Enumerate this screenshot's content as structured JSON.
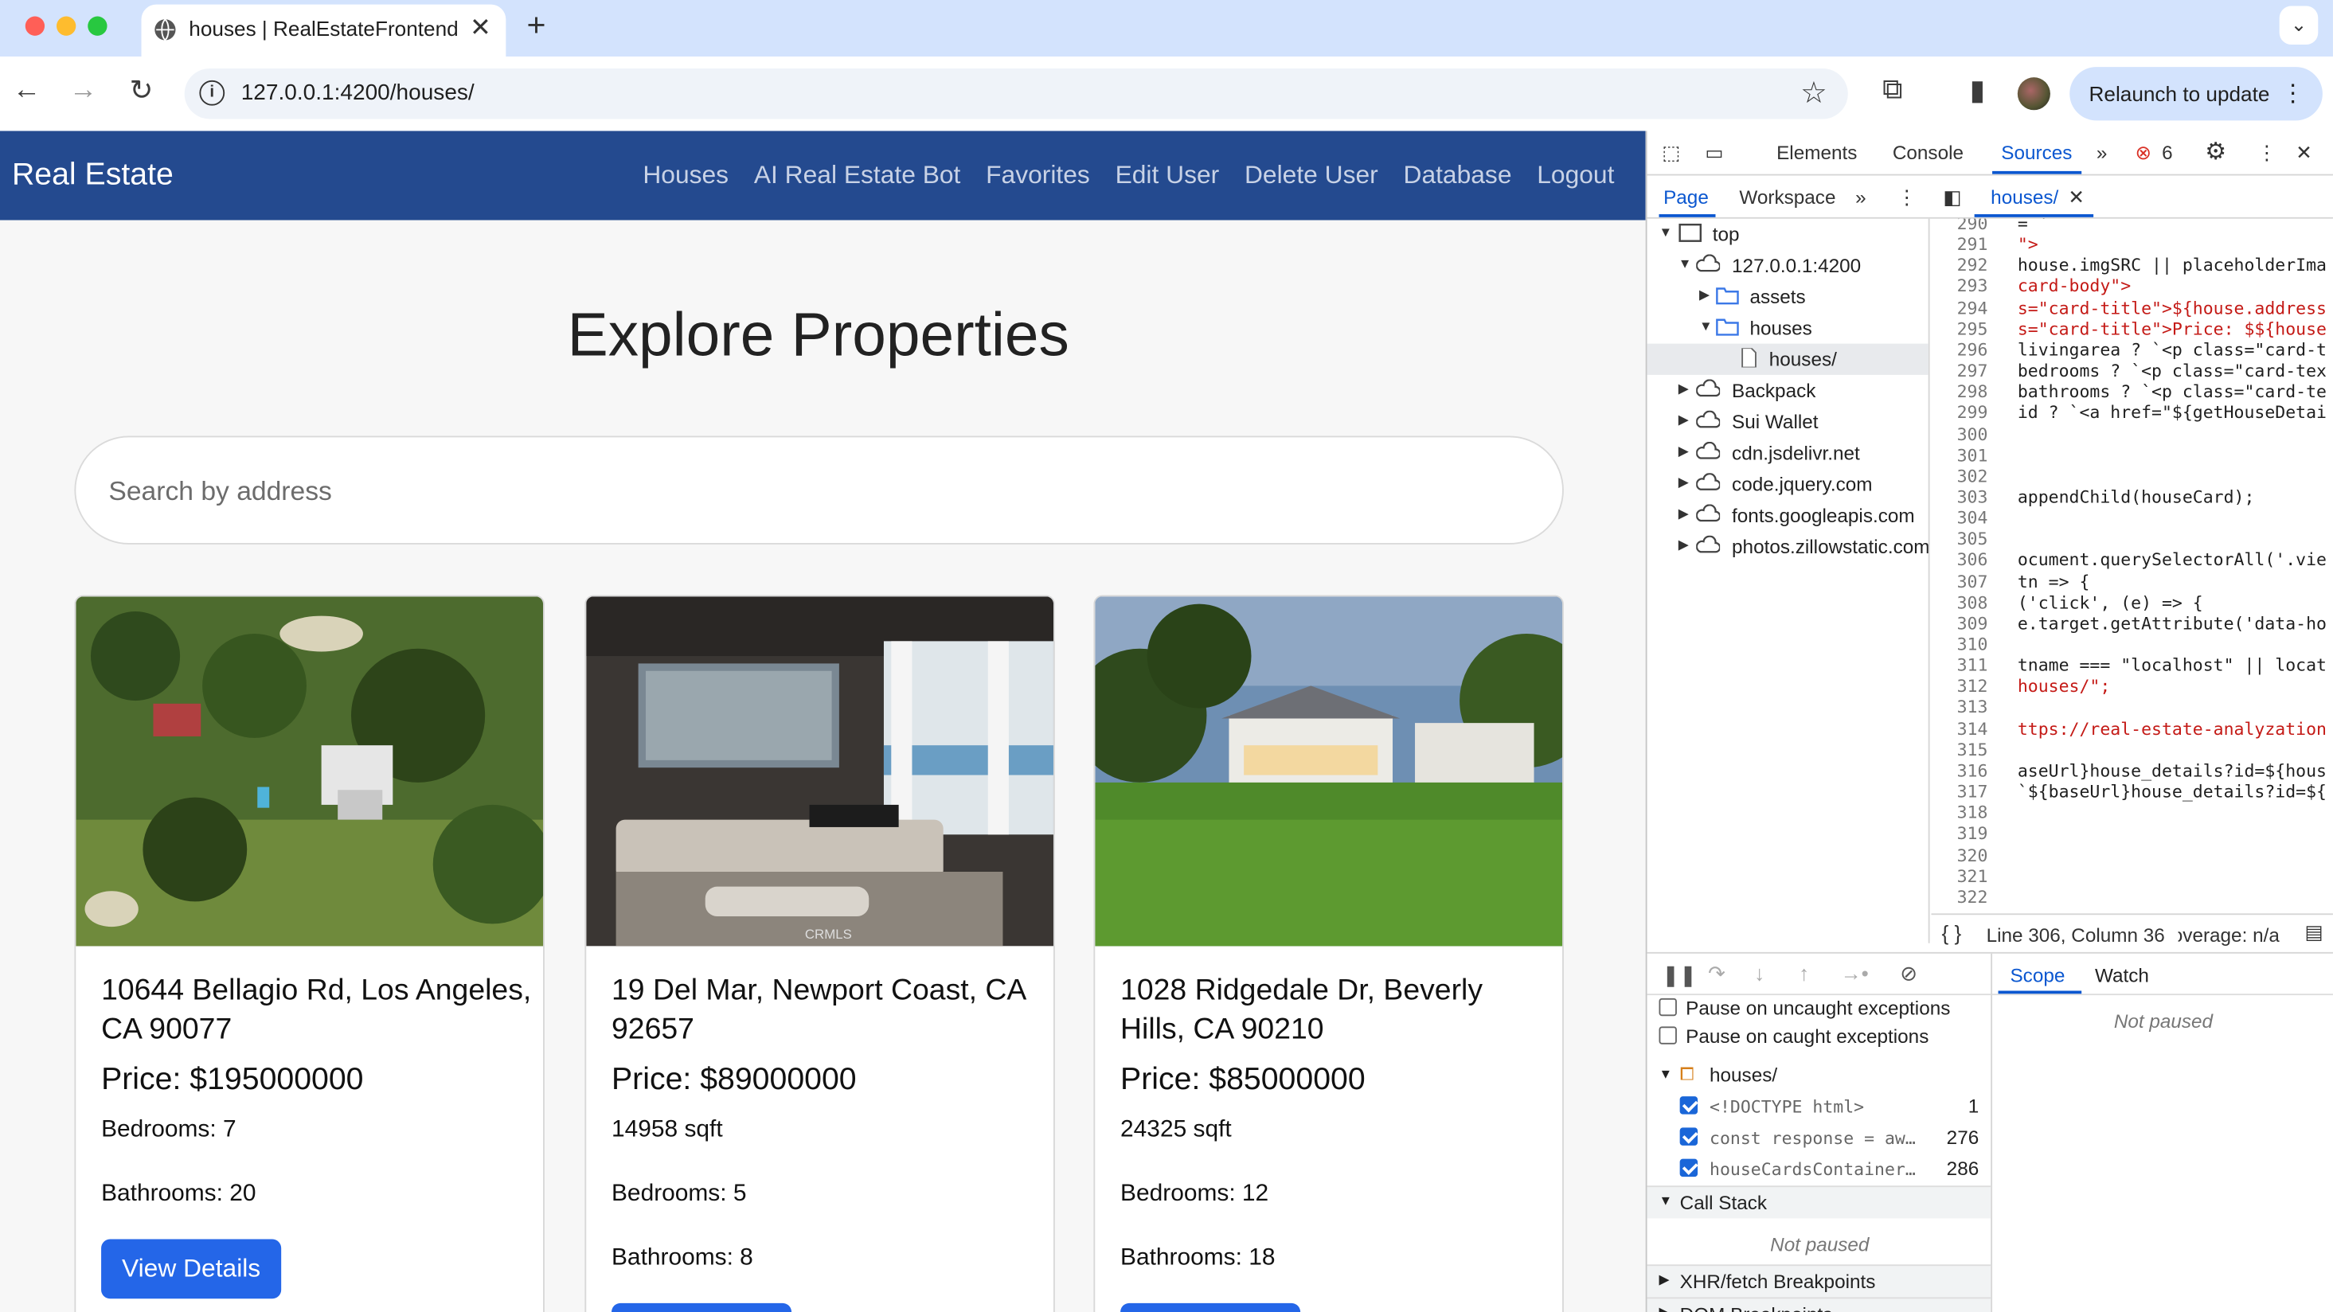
{
  "browser": {
    "tab_title": "houses | RealEstateFrontend",
    "url": "127.0.0.1:4200/houses/",
    "relaunch_label": "Relaunch to update"
  },
  "site": {
    "brand": "Real Estate",
    "nav": [
      "Houses",
      "AI Real Estate Bot",
      "Favorites",
      "Edit User",
      "Delete User",
      "Database",
      "Logout"
    ],
    "heading": "Explore Properties",
    "search_placeholder": "Search by address",
    "cards": [
      {
        "address": "10644 Bellagio Rd, Los Angeles, CA 90077",
        "price": "Price: $195000000",
        "line1": "Bedrooms: 7",
        "line2": "Bathrooms: 20",
        "button": "View Details"
      },
      {
        "address": "19 Del Mar, Newport Coast, CA 92657",
        "price": "Price: $89000000",
        "line1": "14958 sqft",
        "line2": "Bedrooms: 5",
        "line3": "Bathrooms: 8"
      },
      {
        "address": "1028 Ridgedale Dr, Beverly Hills, CA 90210",
        "price": "Price: $85000000",
        "line1": "24325 sqft",
        "line2": "Bedrooms: 12",
        "line3": "Bathrooms: 18"
      }
    ],
    "image_watermark": "CRMLS"
  },
  "devtools": {
    "tabs": [
      "Elements",
      "Console",
      "Sources"
    ],
    "error_count": "6",
    "subtabs": [
      "Page",
      "Workspace"
    ],
    "open_file": "houses/",
    "tree": [
      {
        "label": "top"
      },
      {
        "label": "127.0.0.1:4200"
      },
      {
        "label": "assets"
      },
      {
        "label": "houses"
      },
      {
        "label": "houses/"
      },
      {
        "label": "Backpack"
      },
      {
        "label": "Sui Wallet"
      },
      {
        "label": "cdn.jsdelivr.net"
      },
      {
        "label": "code.jquery.com"
      },
      {
        "label": "fonts.googleapis.com"
      },
      {
        "label": "photos.zillowstatic.com"
      }
    ],
    "code_lines": [
      {
        "n": "290",
        "t": "= `"
      },
      {
        "n": "291",
        "t": "\">"
      },
      {
        "n": "292",
        "t": "house.imgSRC || placeholderIma"
      },
      {
        "n": "293",
        "t": "card-body\">"
      },
      {
        "n": "294",
        "t": "s=\"card-title\">${house.address"
      },
      {
        "n": "295",
        "t": "s=\"card-title\">Price: $${house"
      },
      {
        "n": "296",
        "t": "livingarea ? `<p class=\"card-t"
      },
      {
        "n": "297",
        "t": "bedrooms ? `<p class=\"card-tex"
      },
      {
        "n": "298",
        "t": "bathrooms ? `<p class=\"card-te"
      },
      {
        "n": "299",
        "t": "id ? `<a href=\"${getHouseDetai"
      },
      {
        "n": "300",
        "t": ""
      },
      {
        "n": "301",
        "t": ""
      },
      {
        "n": "302",
        "t": ""
      },
      {
        "n": "303",
        "t": "appendChild(houseCard);"
      },
      {
        "n": "304",
        "t": ""
      },
      {
        "n": "305",
        "t": ""
      },
      {
        "n": "306",
        "t": "ocument.querySelectorAll('.vie"
      },
      {
        "n": "307",
        "t": "tn => {"
      },
      {
        "n": "308",
        "t": "('click', (e) => {"
      },
      {
        "n": "309",
        "t": "e.target.getAttribute('data-ho"
      },
      {
        "n": "310",
        "t": ""
      },
      {
        "n": "311",
        "t": "tname === \"localhost\" || locat"
      },
      {
        "n": "312",
        "t": "houses/\";"
      },
      {
        "n": "313",
        "t": ""
      },
      {
        "n": "314",
        "t": "ttps://real-estate-analyzation"
      },
      {
        "n": "315",
        "t": ""
      },
      {
        "n": "316",
        "t": "aseUrl}house_details?id=${hous"
      },
      {
        "n": "317",
        "t": "`${baseUrl}house_details?id=${"
      },
      {
        "n": "318",
        "t": ""
      },
      {
        "n": "319",
        "t": ""
      },
      {
        "n": "320",
        "t": ""
      },
      {
        "n": "321",
        "t": ""
      },
      {
        "n": "322",
        "t": ""
      }
    ],
    "status": "Line 306, Column 36",
    "coverage": "Coverage: n/a",
    "pause_uncaught": "Pause on uncaught exceptions",
    "pause_caught": "Pause on caught exceptions",
    "bp_file": "houses/",
    "breakpoints": [
      {
        "code": "<!DOCTYPE html>",
        "line": "1"
      },
      {
        "code": "const response = aw…",
        "line": "276"
      },
      {
        "code": "houseCardsContainer…",
        "line": "286"
      }
    ],
    "call_stack": "Call Stack",
    "not_paused": "Not paused",
    "xhr": "XHR/fetch Breakpoints",
    "dom_bp": "DOM Breakpoints",
    "scope_tab": "Scope",
    "watch_tab": "Watch"
  }
}
